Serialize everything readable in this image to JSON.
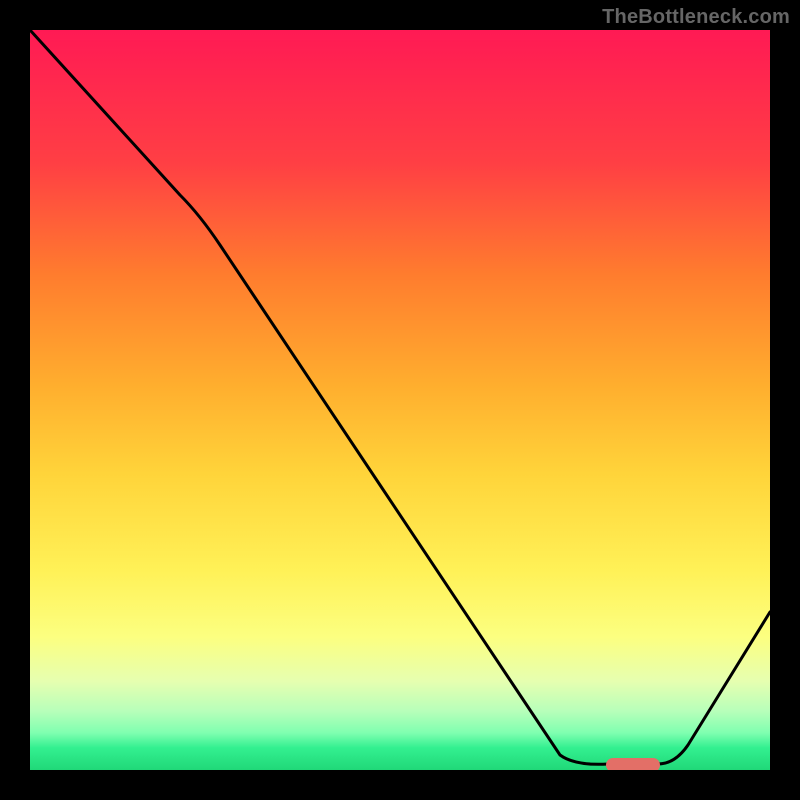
{
  "watermark": "TheBottleneck.com",
  "colors": {
    "bg": "#000000",
    "curve": "#000000",
    "marker": "#e36f67",
    "watermark_text": "#666666"
  },
  "chart_data": {
    "type": "line",
    "title": "",
    "xlabel": "",
    "ylabel": "",
    "xlim": [
      0,
      100
    ],
    "ylim": [
      0,
      100
    ],
    "grid": false,
    "legend": null,
    "background_gradient": {
      "type": "linear-vertical",
      "stops": [
        {
          "pos": 0,
          "color": "#ff1a54"
        },
        {
          "pos": 18,
          "color": "#ff3f44"
        },
        {
          "pos": 33,
          "color": "#ff7c2e"
        },
        {
          "pos": 48,
          "color": "#ffae2e"
        },
        {
          "pos": 60,
          "color": "#ffd43a"
        },
        {
          "pos": 73,
          "color": "#fff157"
        },
        {
          "pos": 82,
          "color": "#fcff80"
        },
        {
          "pos": 88,
          "color": "#e6ffb0"
        },
        {
          "pos": 92,
          "color": "#b8ffba"
        },
        {
          "pos": 95,
          "color": "#7fffb0"
        },
        {
          "pos": 97,
          "color": "#33f090"
        },
        {
          "pos": 100,
          "color": "#20d878"
        }
      ]
    },
    "series": [
      {
        "name": "bottleneck-curve",
        "x": [
          0,
          20,
          72,
          78,
          85,
          100
        ],
        "values": [
          100,
          78,
          2,
          1,
          1,
          21
        ]
      }
    ],
    "markers": [
      {
        "name": "optimal-range",
        "x_start": 78,
        "x_end": 85,
        "y": 1
      }
    ],
    "annotations": []
  }
}
